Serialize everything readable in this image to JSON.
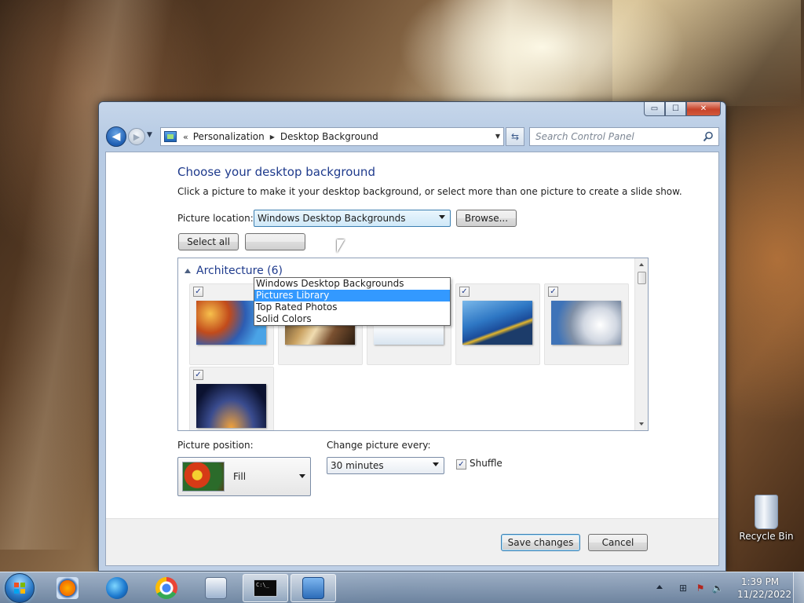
{
  "window": {
    "caption_buttons": {
      "minimize": "▭",
      "maximize": "☐",
      "close": "✕"
    }
  },
  "nav": {
    "back_icon": "◀",
    "forward_icon": "▶",
    "breadcrumb_prefix": "«",
    "breadcrumbs": [
      "Personalization",
      "Desktop Background"
    ],
    "search_placeholder": "Search Control Panel"
  },
  "main": {
    "title": "Choose your desktop background",
    "subtitle": "Click a picture to make it your desktop background, or select more than one picture to create a slide show.",
    "picture_location_label": "Picture location:",
    "picture_location_value": "Windows Desktop Backgrounds",
    "browse_label": "Browse...",
    "select_all_label": "Select all",
    "location_options": [
      "Windows Desktop Backgrounds",
      "Pictures Library",
      "Top Rated Photos",
      "Solid Colors"
    ],
    "location_highlighted": "Pictures Library",
    "gallery": {
      "group_name": "Architecture (6)",
      "tiles": [
        {
          "checked": true,
          "image": "seattle-space-needle"
        },
        {
          "checked": true,
          "image": "metal-curves"
        },
        {
          "checked": true,
          "image": "white-building"
        },
        {
          "checked": true,
          "image": "blue-tower"
        },
        {
          "checked": true,
          "image": "dotted-facade"
        },
        {
          "checked": true,
          "image": "night-arch"
        }
      ]
    },
    "picture_position_label": "Picture position:",
    "picture_position_value": "Fill",
    "change_every_label": "Change picture every:",
    "change_every_value": "30 minutes",
    "shuffle_label": "Shuffle",
    "shuffle_checked": true,
    "check_mark": "✓"
  },
  "footer": {
    "save_label": "Save changes",
    "cancel_label": "Cancel"
  },
  "desktop": {
    "recycle_bin_label": "Recycle Bin"
  },
  "taskbar": {
    "apps": [
      "windows-media-player",
      "network",
      "google-chrome",
      "remote-desktop",
      "command-prompt",
      "control-panel"
    ],
    "cmd_text": "C:\\_",
    "clock_time": "1:39 PM",
    "clock_date": "11/22/2022"
  },
  "colors": {
    "accent_title": "#1e3a8c",
    "selection": "#3399ff"
  }
}
